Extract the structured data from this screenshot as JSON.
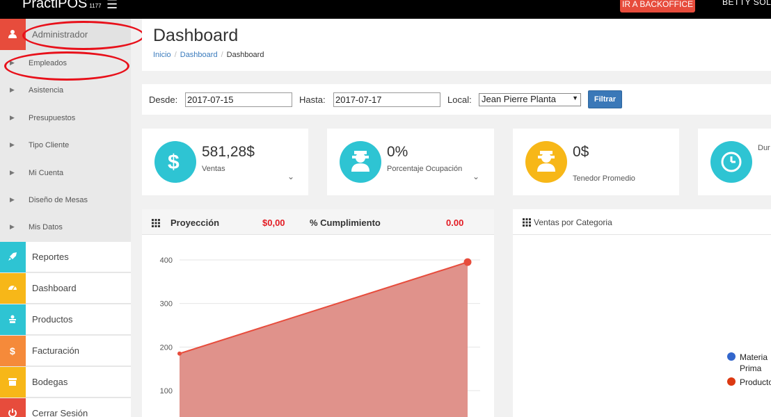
{
  "topbar": {
    "brand": "PractiPOS",
    "brand_sub": "1177",
    "menu_icon": "hamburger-icon",
    "backoffice_label": "IR A BACKOFFICE",
    "username": "BETTY SOL"
  },
  "sidebar": {
    "admin_label": "Administrador",
    "sub_items": [
      {
        "label": "Empleados"
      },
      {
        "label": "Asistencia"
      },
      {
        "label": "Presupuestos"
      },
      {
        "label": "Tipo Cliente"
      },
      {
        "label": "Mi Cuenta"
      },
      {
        "label": "Diseño de Mesas"
      },
      {
        "label": "Mis Datos"
      }
    ],
    "main_items": [
      {
        "label": "Reportes",
        "icon": "rocket-icon",
        "color": "#2ec4d3"
      },
      {
        "label": "Dashboard",
        "icon": "dashboard-icon",
        "color": "#f7b718"
      },
      {
        "label": "Productos",
        "icon": "products-icon",
        "color": "#2ec4d3"
      },
      {
        "label": "Facturación",
        "icon": "dollar-icon",
        "color": "#f58a3a"
      },
      {
        "label": "Bodegas",
        "icon": "box-icon",
        "color": "#f7b718"
      },
      {
        "label": "Cerrar Sesión",
        "icon": "power-icon",
        "color": "#e74c3c"
      }
    ]
  },
  "header": {
    "title": "Dashboard",
    "breadcrumb": [
      "Inicio",
      "Dashboard",
      "Dashboard"
    ]
  },
  "filter": {
    "desde_label": "Desde:",
    "desde_value": "2017-07-15",
    "hasta_label": "Hasta:",
    "hasta_value": "2017-07-17",
    "local_label": "Local:",
    "local_value": "Jean Pierre Planta",
    "button_label": "Filtrar"
  },
  "kpis": [
    {
      "value": "581,28$",
      "label": "Ventas",
      "icon": "dollar-icon",
      "color": "#2ec4d3"
    },
    {
      "value": "0%",
      "label": "Porcentaje Ocupación",
      "icon": "waiter-icon",
      "color": "#2ec4d3"
    },
    {
      "value": "0$",
      "label": "Tenedor Promedio",
      "icon": "waiter-icon",
      "color": "#f7b718"
    },
    {
      "value": "",
      "label": "Dur",
      "icon": "clock-icon",
      "color": "#2ec4d3"
    }
  ],
  "projection": {
    "title": "Proyección",
    "value": "$0,00",
    "cumplimiento_label": "% Cumplimiento",
    "cumplimiento_value": "0.00"
  },
  "categories": {
    "title": "Ventas por Categoria",
    "legend": [
      {
        "label": "Materia Prima",
        "color": "#3366cc"
      },
      {
        "label": "Producto",
        "color": "#dc3912"
      }
    ]
  },
  "chart_data": {
    "type": "area",
    "x": [
      0,
      1
    ],
    "values": [
      185,
      395
    ],
    "ylim": [
      0,
      420
    ],
    "yticks": [
      100,
      200,
      300,
      400
    ],
    "grid": true,
    "color": "#e74c3c"
  }
}
